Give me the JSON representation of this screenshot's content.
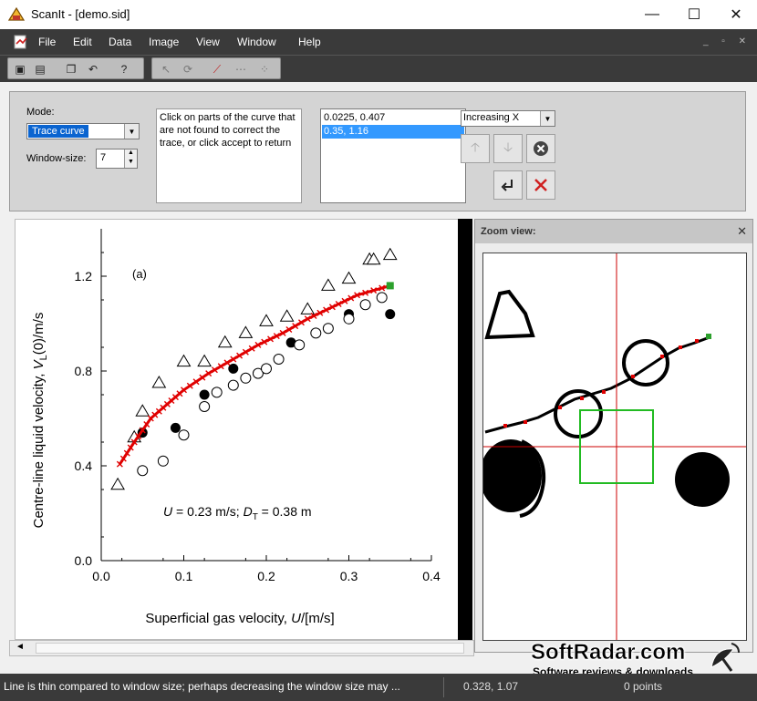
{
  "window": {
    "title": "ScanIt - [demo.sid]",
    "minimize": "—",
    "maximize": "☐",
    "close": "✕"
  },
  "menu": {
    "items": [
      "File",
      "Edit",
      "Data",
      "Image",
      "View",
      "Window",
      "Help"
    ]
  },
  "panel": {
    "mode_label": "Mode:",
    "mode_value": "Trace curve",
    "window_size_label": "Window-size:",
    "window_size_value": "7",
    "hint": "Click on parts of the curve that are not found to correct the trace, or click accept to return",
    "list_items": [
      "0.0225, 0.407",
      "0.35, 1.16"
    ],
    "selected_index": 1,
    "order_value": "Increasing X"
  },
  "chart_data": {
    "type": "scatter",
    "annotation": "(a)",
    "formula_parts": [
      "U",
      " = 0.23 m/s; ",
      "D",
      "T",
      " = 0.38 m"
    ],
    "ylabel_parts": [
      "Centre-line liquid velocity,  ",
      "V",
      "L",
      "(0)/m/s"
    ],
    "xlabel_parts": [
      "Superficial gas velocity, ",
      "U",
      "/[m/s]"
    ],
    "xlim": [
      0,
      0.4
    ],
    "ylim": [
      0,
      1.4
    ],
    "x_ticks": [
      0.0,
      0.1,
      0.2,
      0.3,
      0.4
    ],
    "x_tick_labels": [
      "0.0",
      "0.1",
      "0.2",
      "0.3",
      "0.4"
    ],
    "y_ticks": [
      0.0,
      0.4,
      0.8,
      1.2
    ],
    "y_tick_labels": [
      "0.0",
      "0.4",
      "0.8",
      "1.2"
    ],
    "series": [
      {
        "marker": "triangle",
        "points": [
          [
            0.02,
            0.32
          ],
          [
            0.04,
            0.52
          ],
          [
            0.05,
            0.63
          ],
          [
            0.07,
            0.75
          ],
          [
            0.1,
            0.84
          ],
          [
            0.125,
            0.84
          ],
          [
            0.15,
            0.92
          ],
          [
            0.175,
            0.96
          ],
          [
            0.2,
            1.01
          ],
          [
            0.225,
            1.03
          ],
          [
            0.25,
            1.06
          ],
          [
            0.275,
            1.16
          ],
          [
            0.3,
            1.19
          ],
          [
            0.325,
            1.27
          ],
          [
            0.33,
            1.27
          ],
          [
            0.35,
            1.29
          ]
        ]
      },
      {
        "marker": "filled-circle",
        "points": [
          [
            0.05,
            0.54
          ],
          [
            0.09,
            0.56
          ],
          [
            0.125,
            0.7
          ],
          [
            0.16,
            0.81
          ],
          [
            0.23,
            0.92
          ],
          [
            0.3,
            1.04
          ],
          [
            0.35,
            1.04
          ]
        ]
      },
      {
        "marker": "open-circle",
        "points": [
          [
            0.05,
            0.38
          ],
          [
            0.075,
            0.42
          ],
          [
            0.1,
            0.53
          ],
          [
            0.125,
            0.65
          ],
          [
            0.14,
            0.71
          ],
          [
            0.16,
            0.74
          ],
          [
            0.175,
            0.77
          ],
          [
            0.19,
            0.79
          ],
          [
            0.2,
            0.81
          ],
          [
            0.215,
            0.85
          ],
          [
            0.24,
            0.91
          ],
          [
            0.26,
            0.96
          ],
          [
            0.275,
            0.98
          ],
          [
            0.3,
            1.02
          ],
          [
            0.32,
            1.08
          ],
          [
            0.34,
            1.11
          ]
        ]
      },
      {
        "marker": "trace",
        "color": "#e00000",
        "points": [
          [
            0.0225,
            0.407
          ],
          [
            0.04,
            0.5
          ],
          [
            0.06,
            0.6
          ],
          [
            0.08,
            0.66
          ],
          [
            0.1,
            0.72
          ],
          [
            0.13,
            0.79
          ],
          [
            0.16,
            0.85
          ],
          [
            0.19,
            0.91
          ],
          [
            0.22,
            0.96
          ],
          [
            0.25,
            1.02
          ],
          [
            0.28,
            1.07
          ],
          [
            0.31,
            1.12
          ],
          [
            0.35,
            1.16
          ]
        ]
      }
    ]
  },
  "zoom": {
    "title": "Zoom view:",
    "close": "✕"
  },
  "scroll": {
    "left": "◄"
  },
  "status": {
    "message": "Line is thin compared to window size; perhaps decreasing the window size may ...",
    "coord": "0.328, 1.07",
    "count": "0 points"
  },
  "watermark": {
    "title": "SoftRadar.com",
    "subtitle": "Software reviews & downloads"
  },
  "colors": {
    "trace": "#e00000",
    "last_point": "#2ca02c",
    "zoom_box": "#22bb22",
    "crosshair": "#cc0000"
  }
}
